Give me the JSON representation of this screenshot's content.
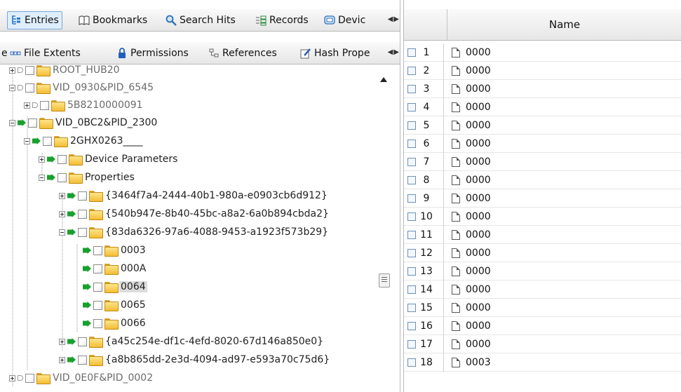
{
  "tabs_top": [
    {
      "label": "Entries",
      "icon": "tree-icon",
      "active": true
    },
    {
      "label": "Bookmarks",
      "icon": "book-icon"
    },
    {
      "label": "Search Hits",
      "icon": "magnifier-icon"
    },
    {
      "label": "Records",
      "icon": "records-icon"
    },
    {
      "label": "Devic",
      "icon": "device-icon"
    }
  ],
  "tabs_bottom": [
    {
      "label": "e",
      "icon": ""
    },
    {
      "label": "File Extents",
      "icon": "extents-icon"
    },
    {
      "label": "Permissions",
      "icon": "lock-icon"
    },
    {
      "label": "References",
      "icon": "references-icon"
    },
    {
      "label": "Hash Prope",
      "icon": "hash-icon"
    }
  ],
  "tree": [
    {
      "label": "ROOT_HUB20",
      "grey": true
    },
    {
      "label": "VID_0930&PID_6545",
      "grey": true
    },
    {
      "label": "5B8210000091",
      "grey": true
    },
    {
      "label": "VID_0BC2&PID_2300"
    },
    {
      "label": "2GHX0263____"
    },
    {
      "label": "Device Parameters"
    },
    {
      "label": "Properties"
    },
    {
      "label": "{3464f7a4-2444-40b1-980a-e0903cb6d912}"
    },
    {
      "label": "{540b947e-8b40-45bc-a8a2-6a0b894cbda2}"
    },
    {
      "label": "{83da6326-97a6-4088-9453-a1923f573b29}"
    },
    {
      "label": "0003"
    },
    {
      "label": "000A"
    },
    {
      "label": "0064",
      "selected": true
    },
    {
      "label": "0065"
    },
    {
      "label": "0066"
    },
    {
      "label": "{a45c254e-df1c-4efd-8020-67d146a850e0}"
    },
    {
      "label": "{a8b865dd-2e3d-4094-ad97-e593a70c75d6}"
    },
    {
      "label": "VID_0E0F&PID_0002",
      "grey": true
    }
  ],
  "grid": {
    "column_name": "Name",
    "rows": [
      {
        "n": "1",
        "name": "0000"
      },
      {
        "n": "2",
        "name": "0000"
      },
      {
        "n": "3",
        "name": "0000"
      },
      {
        "n": "4",
        "name": "0000"
      },
      {
        "n": "5",
        "name": "0000"
      },
      {
        "n": "6",
        "name": "0000"
      },
      {
        "n": "7",
        "name": "0000"
      },
      {
        "n": "8",
        "name": "0000"
      },
      {
        "n": "9",
        "name": "0000"
      },
      {
        "n": "10",
        "name": "0000"
      },
      {
        "n": "11",
        "name": "0000"
      },
      {
        "n": "12",
        "name": "0000"
      },
      {
        "n": "13",
        "name": "0000"
      },
      {
        "n": "14",
        "name": "0000"
      },
      {
        "n": "15",
        "name": "0000"
      },
      {
        "n": "16",
        "name": "0000"
      },
      {
        "n": "17",
        "name": "0000"
      },
      {
        "n": "18",
        "name": "0003"
      }
    ]
  }
}
